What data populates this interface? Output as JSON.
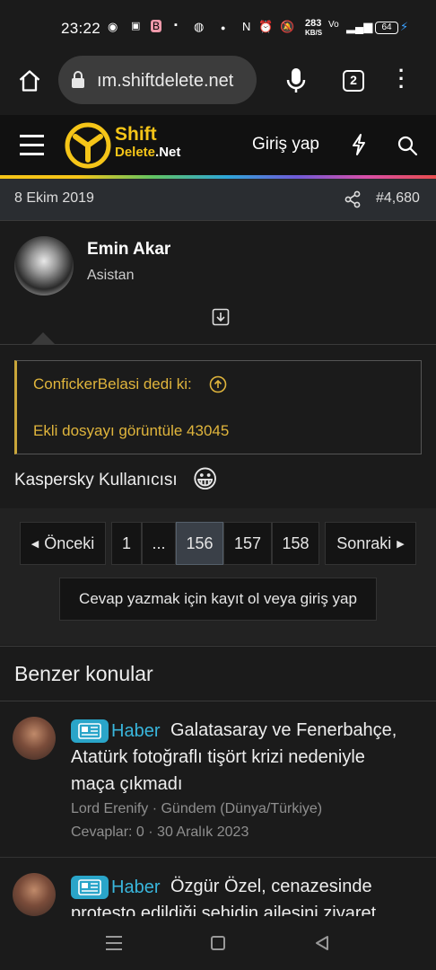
{
  "status_bar": {
    "time": "23:22",
    "speed_value": "283",
    "speed_unit": "KB/S",
    "battery": "64"
  },
  "browser": {
    "url": "ım.shiftdelete.net",
    "tab_count": "2"
  },
  "site_header": {
    "logo_top": "Shift",
    "logo_bottom_1": "Delete",
    "logo_bottom_2": ".Net",
    "login": "Giriş yap"
  },
  "post": {
    "date": "8 Ekim 2019",
    "post_number": "#4,680",
    "author": "Emin Akar",
    "role": "Asistan",
    "quote_author": "ConfickerBelasi dedi ki:",
    "quote_link": "Ekli dosyayı görüntüle 43045",
    "body": "Kaspersky Kullanıcısı",
    "emoji": "😀"
  },
  "pagination": {
    "prev": "Önceki",
    "pages": [
      "1",
      "...",
      "156",
      "157",
      "158"
    ],
    "active": "156",
    "next": "Sonraki",
    "register_prompt": "Cevap yazmak için kayıt ol veya giriş yap"
  },
  "similar": {
    "heading": "Benzer konular",
    "items": [
      {
        "tag": "Haber",
        "title_line1": "Galatasaray ve Fenerbahçe,",
        "title_line2": "Atatürk fotoğraflı tişört krizi nedeniyle",
        "title_line3": "maça çıkmadı",
        "meta": "Lord Erenify · Gündem (Dünya/Türkiye)",
        "stats": "Cevaplar: 0 · 30 Aralık 2023"
      },
      {
        "tag": "Haber",
        "title_line1": "Özgür Özel, cenazesinde",
        "title_line2": "protesto edildiği şehidin ailesini ziyaret"
      }
    ]
  },
  "colors": {
    "accent_gold": "#c9a63a",
    "tag_blue": "#39b6dc",
    "logo_yellow": "#f5c518"
  }
}
